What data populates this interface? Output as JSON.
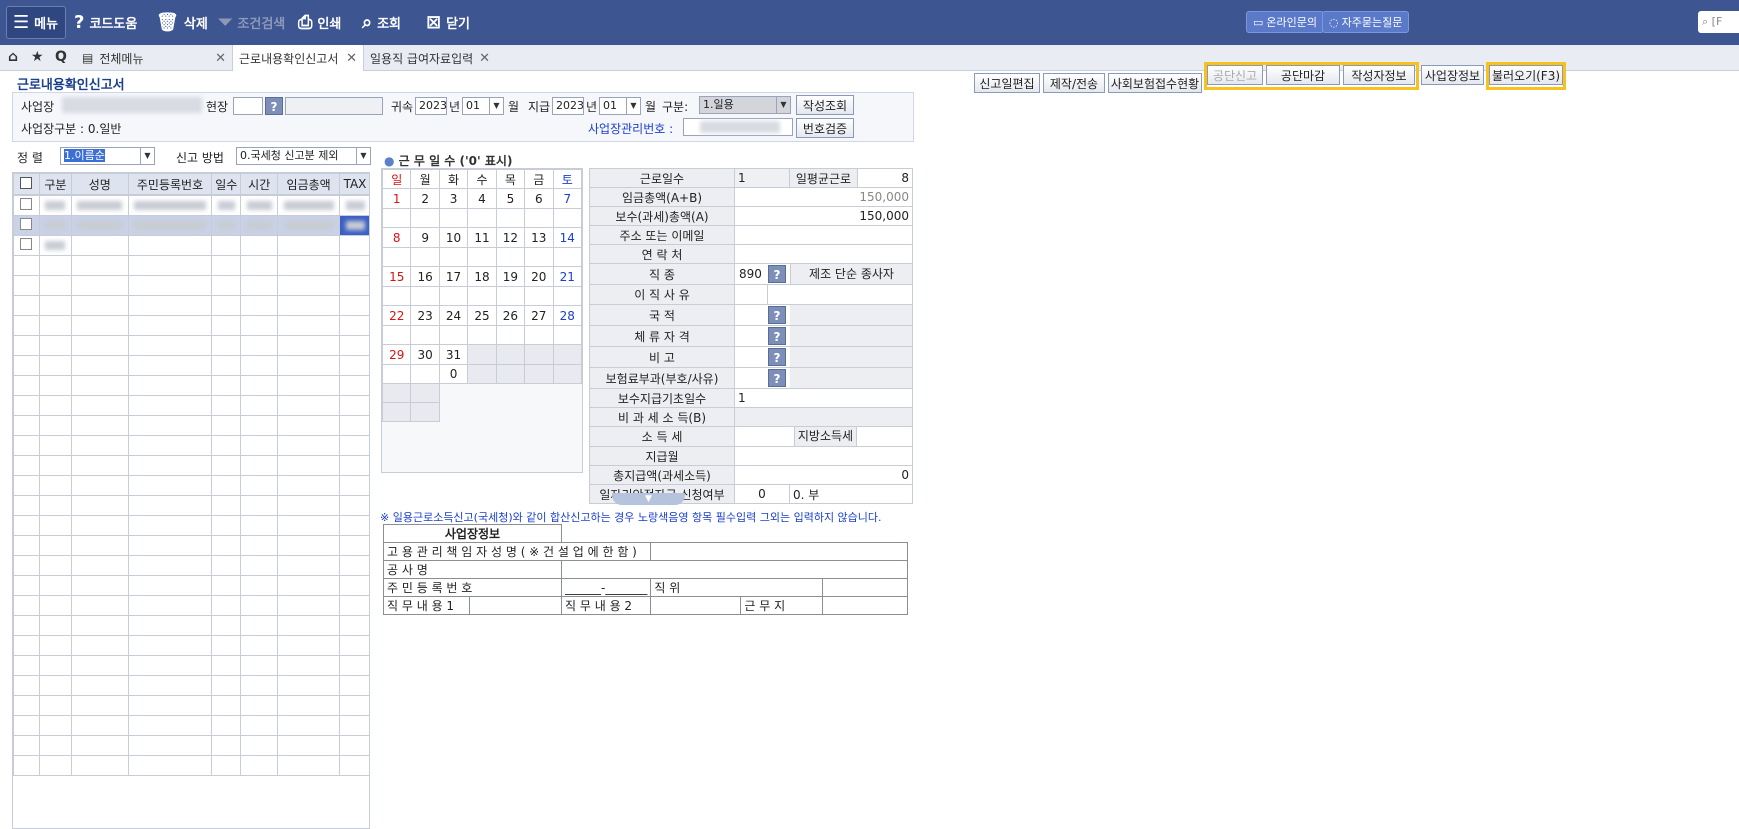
{
  "toolbar": {
    "menu": "메뉴",
    "code_help": "코드도움",
    "delete": "삭제",
    "cond_search": "조건검색",
    "print": "인쇄",
    "view": "조회",
    "close": "닫기",
    "online_inquiry": "온라인문의",
    "faq": "자주묻는질문",
    "search_placeholder": "[F"
  },
  "tabs": {
    "all_menu": "전체메뉴",
    "tab1": "근로내용확인신고서",
    "tab2": "일용직 급여자료입력"
  },
  "page": {
    "title": "근로내용확인신고서"
  },
  "actions": {
    "edit_report": "신고일편집",
    "produce": "제작/전송",
    "insurance_status": "사회보험접수현황",
    "gongdan_report": "공단신고",
    "gongdan_close": "공단마감",
    "writer_info": "작성자정보",
    "business_info": "사업장정보",
    "load": "불러오기(F3)"
  },
  "filter": {
    "biz_label": "사업장",
    "site_label": "현장",
    "attr_label": "귀속",
    "attr_year": "2023",
    "year_unit": "년",
    "attr_month": "01",
    "month_unit": "월",
    "pay_label": "지급",
    "pay_year": "2023",
    "pay_month": "01",
    "kind_label": "구분:",
    "kind_value": "1.일용",
    "write_query": "작성조회",
    "biz_type": "사업장구분 : 0.일반",
    "mgmt_no_label": "사업장관리번호 :",
    "verify_no": "번호검증"
  },
  "sort": {
    "label": "정 렬",
    "value": "1.이름순",
    "method_label": "신고 방법",
    "method_value": "0.국세청 신고분 제외"
  },
  "list": {
    "headers": [
      "구분",
      "성명",
      "주민등록번호",
      "일수",
      "시간",
      "임금총액",
      "TAX"
    ]
  },
  "calendar": {
    "title": "근 무 일 수 ('0' 표시)",
    "days": [
      "일",
      "월",
      "화",
      "수",
      "목",
      "금",
      "토"
    ],
    "weeks": [
      [
        "1",
        "2",
        "3",
        "4",
        "5",
        "6",
        "7"
      ],
      [
        "8",
        "9",
        "10",
        "11",
        "12",
        "13",
        "14"
      ],
      [
        "15",
        "16",
        "17",
        "18",
        "19",
        "20",
        "21"
      ],
      [
        "22",
        "23",
        "24",
        "25",
        "26",
        "27",
        "28"
      ],
      [
        "29",
        "30",
        "31",
        "",
        "",
        "",
        ""
      ]
    ],
    "zero": "0"
  },
  "detail": {
    "work_days_label": "근로일수",
    "work_days": "1",
    "avg_hours_label": "일평균근로",
    "avg_hours": "8",
    "wage_total_label": "임금총액(A+B)",
    "wage_total": "150,000",
    "pay_taxable_label": "보수(과세)총액(A)",
    "pay_taxable": "150,000",
    "address_label": "주소 또는 이메일",
    "contact_label": "연 락 처",
    "job_label": "직 종",
    "job_code": "890",
    "job_name": "제조 단순 종사자",
    "leave_label": "이 직 사 유",
    "nation_label": "국 적",
    "stay_label": "체 류 자 격",
    "note_label": "비 고",
    "insurance_label": "보험료부과(부호/사유)",
    "base_days_label": "보수지급기초일수",
    "base_days": "1",
    "nontax_label": "비 과 세 소 득(B)",
    "income_tax_label": "소 득 세",
    "local_tax_label": "지방소득세",
    "pay_month_label": "지급월",
    "total_pay_label": "총지급액(과세소득)",
    "total_pay": "0",
    "subsidy_label": "일자리안정자금 신청여부",
    "subsidy_code": "0",
    "subsidy_value": "0. 부"
  },
  "notice": "※ 일용근로소득신고(국세청)와 같이 합산신고하는 경우 노랑색음영 항목 필수입력 그외는 입력하지 않습니다.",
  "bizinfo": {
    "title": "사업장정보",
    "manager_label": "고 용 관 리 책 임 자 성 명 ( ※ 건 설 업 에   한 함 )",
    "company_label": "공                 사                 명",
    "ssn_label": "주       민       등       록       번       호",
    "ssn_value": "______-_______",
    "position_label": "직           위",
    "duty1_label": "직 무 내 용 1",
    "duty2_label": "직 무 내 용 2",
    "workplace_label": "근      무      지"
  }
}
